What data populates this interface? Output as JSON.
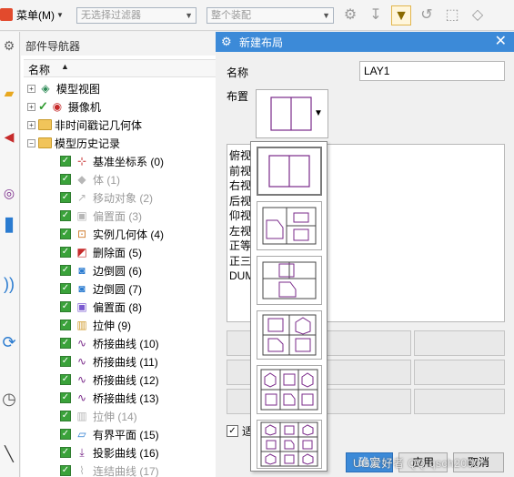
{
  "toolbar": {
    "menu_label": "菜单(M)",
    "filter_placeholder": "无选择过滤器",
    "assembly_placeholder": "整个装配",
    "icons": [
      "snap-to-grid-icon",
      "snap-point-icon",
      "selection-filter-icon",
      "undo-arc-icon",
      "snap-cube-icon",
      "view-cube-icon"
    ]
  },
  "left_strip": {
    "icons": [
      "settings-icon",
      "assembly-icon",
      "feature-icon",
      "wave-icon",
      "history-icon",
      "clock-icon",
      "knife-icon"
    ]
  },
  "navigator": {
    "title": "部件导航器",
    "column_name": "名称",
    "nodes": [
      {
        "label": "模型视图",
        "kind": "branch",
        "expander": "+",
        "icon": "model-view-icon"
      },
      {
        "label": "摄像机",
        "kind": "branch",
        "expander": "+",
        "icon": "camera-icon",
        "checked": true
      },
      {
        "label": "非时间戳记几何体",
        "kind": "branch",
        "expander": "+",
        "icon": "folder-icon"
      },
      {
        "label": "模型历史记录",
        "kind": "branch",
        "expander": "−",
        "icon": "folder-icon"
      },
      {
        "label": "基准坐标系 (0)",
        "kind": "feature",
        "icon": "datum-csys-icon",
        "checked": true,
        "dim": false
      },
      {
        "label": "体 (1)",
        "kind": "feature",
        "icon": "body-icon",
        "checked": true,
        "dim": true
      },
      {
        "label": "移动对象 (2)",
        "kind": "feature",
        "icon": "move-object-icon",
        "checked": true,
        "dim": true
      },
      {
        "label": "偏置面 (3)",
        "kind": "feature",
        "icon": "offset-face-icon",
        "checked": true,
        "dim": true
      },
      {
        "label": "实例几何体 (4)",
        "kind": "feature",
        "icon": "instance-geometry-icon",
        "checked": true,
        "dim": false
      },
      {
        "label": "删除面 (5)",
        "kind": "feature",
        "icon": "delete-face-icon",
        "checked": true,
        "dim": false
      },
      {
        "label": "边倒圆 (6)",
        "kind": "feature",
        "icon": "edge-blend-icon",
        "checked": true,
        "dim": false
      },
      {
        "label": "边倒圆 (7)",
        "kind": "feature",
        "icon": "edge-blend-icon",
        "checked": true,
        "dim": false
      },
      {
        "label": "偏置面 (8)",
        "kind": "feature",
        "icon": "offset-face-icon",
        "checked": true,
        "dim": false
      },
      {
        "label": "拉伸 (9)",
        "kind": "feature",
        "icon": "extrude-icon",
        "checked": true,
        "dim": false
      },
      {
        "label": "桥接曲线 (10)",
        "kind": "feature",
        "icon": "bridge-curve-icon",
        "checked": true,
        "dim": false
      },
      {
        "label": "桥接曲线 (11)",
        "kind": "feature",
        "icon": "bridge-curve-icon",
        "checked": true,
        "dim": false
      },
      {
        "label": "桥接曲线 (12)",
        "kind": "feature",
        "icon": "bridge-curve-icon",
        "checked": true,
        "dim": false
      },
      {
        "label": "桥接曲线 (13)",
        "kind": "feature",
        "icon": "bridge-curve-icon",
        "checked": true,
        "dim": false
      },
      {
        "label": "拉伸 (14)",
        "kind": "feature",
        "icon": "extrude-icon",
        "checked": true,
        "dim": true
      },
      {
        "label": "有界平面 (15)",
        "kind": "feature",
        "icon": "bounded-plane-icon",
        "checked": true,
        "dim": false
      },
      {
        "label": "投影曲线 (16)",
        "kind": "feature",
        "icon": "project-curve-icon",
        "checked": true,
        "dim": false
      },
      {
        "label": "连结曲线 (17)",
        "kind": "feature",
        "icon": "join-curve-icon",
        "checked": true,
        "dim": true
      }
    ]
  },
  "dialog": {
    "title": "新建布局",
    "name_label": "名称",
    "name_value": "LAY1",
    "layout_label": "布置",
    "views": [
      "俯视",
      "前视",
      "右视",
      "后视",
      "仰视",
      "左视",
      "正等",
      "正三",
      "DUM"
    ],
    "checkbox_label": "适",
    "ok_label": "确定",
    "apply_label": "应用",
    "cancel_label": "取消"
  },
  "layout_options": [
    "two-views-side-by-side",
    "three-views-a",
    "three-views-b",
    "four-views",
    "six-views",
    "nine-views"
  ],
  "watermark": "UG爱好者 QQ:qsch2000*",
  "colors": {
    "accent": "#3c8ad8",
    "check_green": "#3aa23a",
    "layout_line": "#7a2a8a",
    "folder_yellow": "#f1c45a"
  }
}
